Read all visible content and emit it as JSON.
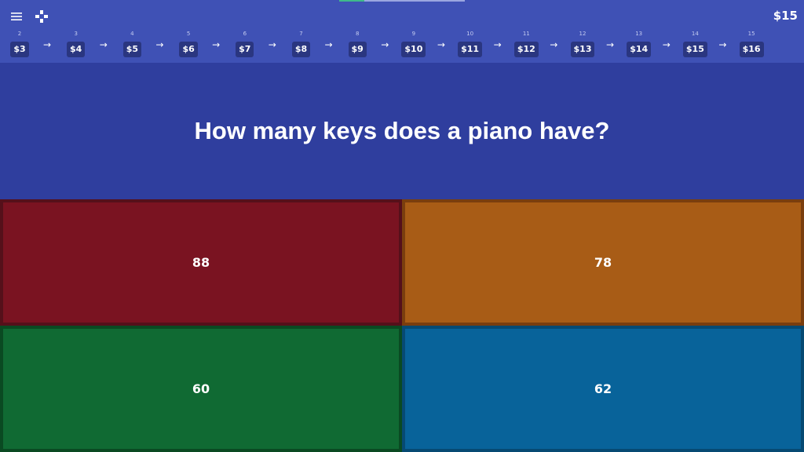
{
  "progress": {
    "fraction": 0.2
  },
  "header": {
    "menu_icon": "menu-icon",
    "game_icon": "gamepad-icon",
    "balance": "$15"
  },
  "ladder": [
    {
      "step": "2",
      "prize": "$3"
    },
    {
      "step": "3",
      "prize": "$4"
    },
    {
      "step": "4",
      "prize": "$5"
    },
    {
      "step": "5",
      "prize": "$6"
    },
    {
      "step": "6",
      "prize": "$7"
    },
    {
      "step": "7",
      "prize": "$8"
    },
    {
      "step": "8",
      "prize": "$9"
    },
    {
      "step": "9",
      "prize": "$10"
    },
    {
      "step": "10",
      "prize": "$11"
    },
    {
      "step": "11",
      "prize": "$12"
    },
    {
      "step": "12",
      "prize": "$13"
    },
    {
      "step": "13",
      "prize": "$14"
    },
    {
      "step": "14",
      "prize": "$15"
    },
    {
      "step": "15",
      "prize": "$16"
    }
  ],
  "arrow_glyph": "→",
  "question": "How many keys does a piano have?",
  "answers": [
    "88",
    "78",
    "60",
    "62"
  ],
  "colors": {
    "header": "#3f51b5",
    "background": "#2f3e9e",
    "answer_red": "#7a1321",
    "answer_orange": "#a85c16",
    "answer_green": "#106a33",
    "answer_blue": "#08639a"
  }
}
